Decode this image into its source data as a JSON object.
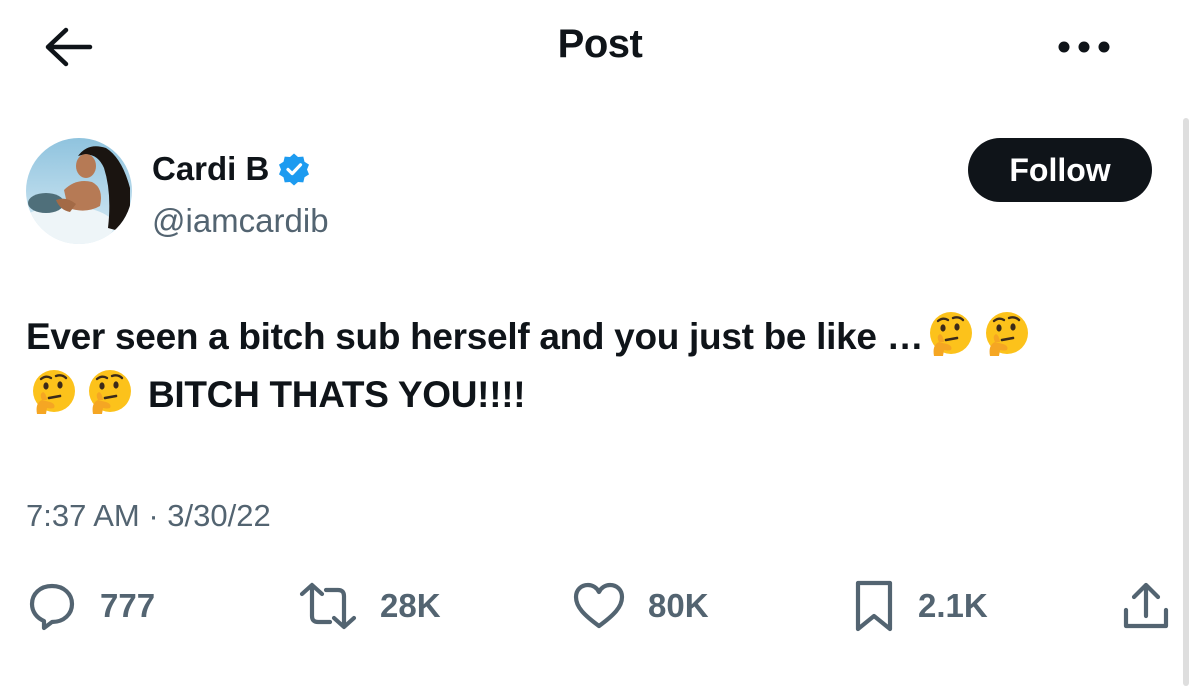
{
  "header": {
    "title": "Post"
  },
  "author": {
    "name": "Cardi B",
    "handle": "@iamcardib",
    "verified": true
  },
  "follow_label": "Follow",
  "tweet": {
    "line1": "Ever seen a bitch sub herself and you just be like …",
    "line2": "BITCH THATS YOU!!!!",
    "emoji": "thinking-face"
  },
  "timestamp": "7:37 AM · 3/30/22",
  "stats": {
    "replies": "777",
    "reposts": "28K",
    "likes": "80K",
    "bookmarks": "2.1K"
  },
  "colors": {
    "text": "#0f1419",
    "secondary": "#536471",
    "verified": "#1d9bf0",
    "button_bg": "#0f1419"
  }
}
